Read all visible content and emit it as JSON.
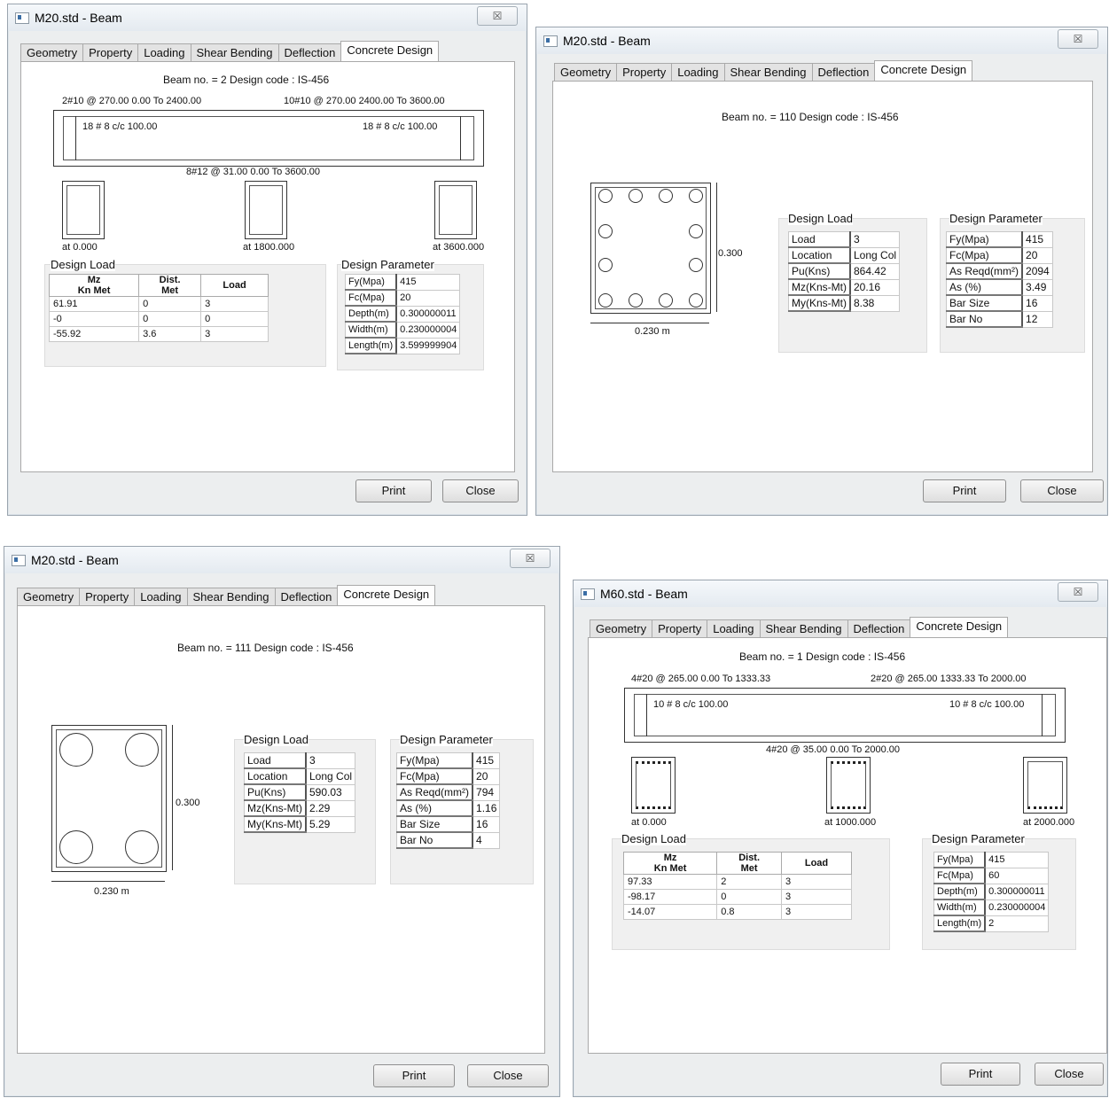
{
  "tabs": [
    "Geometry",
    "Property",
    "Loading",
    "Shear Bending",
    "Deflection",
    "Concrete Design"
  ],
  "close_x": "☒",
  "buttons": {
    "print": "Print",
    "close": "Close"
  },
  "d1": {
    "title": "M20.std - Beam",
    "beam_line": "Beam no. = 2  Design code :  IS-456",
    "top_left_bar": "2#10 @ 270.00 0.00 To 2400.00",
    "top_right_bar": "10#10 @ 270.00 2400.00 To 3600.00",
    "stirrup_left": "18 # 8 c/c 100.00",
    "stirrup_right": "18 # 8 c/c 100.00",
    "bottom_bar": "8#12 @ 31.00 0.00 To 3600.00",
    "sections": [
      "at 0.000",
      "at 1800.000",
      "at 3600.000"
    ],
    "design_load_label": "Design Load",
    "dl_headers": [
      "Mz\nKn Met",
      "Dist.\nMet",
      "Load"
    ],
    "dl_rows": [
      [
        "61.91",
        "0",
        "3"
      ],
      [
        "-0",
        "0",
        "0"
      ],
      [
        "-55.92",
        "3.6",
        "3"
      ]
    ],
    "design_param_label": "Design Parameter",
    "params": [
      [
        "Fy(Mpa)",
        "415"
      ],
      [
        "Fc(Mpa)",
        "20"
      ],
      [
        "Depth(m)",
        "0.300000011"
      ],
      [
        "Width(m)",
        "0.230000004"
      ],
      [
        "Length(m)",
        "3.599999904"
      ]
    ]
  },
  "d2": {
    "title": "M20.std - Beam",
    "beam_line": "Beam no. = 110  Design code :  IS-456",
    "depth_label": "0.300",
    "width_label": "0.230 m",
    "design_load_label": "Design Load",
    "loads": [
      [
        "Load",
        "3"
      ],
      [
        "Location",
        "Long Col"
      ],
      [
        "Pu(Kns)",
        "864.42"
      ],
      [
        "Mz(Kns-Mt)",
        "20.16"
      ],
      [
        "My(Kns-Mt)",
        "8.38"
      ]
    ],
    "design_param_label": "Design Parameter",
    "params": [
      [
        "Fy(Mpa)",
        "415"
      ],
      [
        "Fc(Mpa)",
        "20"
      ],
      [
        "As Reqd(mm²)",
        "2094"
      ],
      [
        "As (%)",
        "3.49"
      ],
      [
        "Bar Size",
        "16"
      ],
      [
        "Bar No",
        "12"
      ]
    ]
  },
  "d3": {
    "title": "M20.std - Beam",
    "beam_line": "Beam no. = 111  Design code :  IS-456",
    "depth_label": "0.300",
    "width_label": "0.230 m",
    "design_load_label": "Design Load",
    "loads": [
      [
        "Load",
        "3"
      ],
      [
        "Location",
        "Long Col"
      ],
      [
        "Pu(Kns)",
        "590.03"
      ],
      [
        "Mz(Kns-Mt)",
        "2.29"
      ],
      [
        "My(Kns-Mt)",
        "5.29"
      ]
    ],
    "design_param_label": "Design Parameter",
    "params": [
      [
        "Fy(Mpa)",
        "415"
      ],
      [
        "Fc(Mpa)",
        "20"
      ],
      [
        "As Reqd(mm²)",
        "794"
      ],
      [
        "As (%)",
        "1.16"
      ],
      [
        "Bar Size",
        "16"
      ],
      [
        "Bar No",
        "4"
      ]
    ]
  },
  "d4": {
    "title": "M60.std - Beam",
    "beam_line": "Beam no. = 1  Design code :  IS-456",
    "top_left_bar": "4#20 @ 265.00 0.00 To 1333.33",
    "top_right_bar": "2#20 @ 265.00 1333.33 To 2000.00",
    "stirrup_left": "10 # 8 c/c 100.00",
    "stirrup_right": "10 # 8 c/c 100.00",
    "bottom_bar": "4#20 @ 35.00 0.00 To 2000.00",
    "sections": [
      "at 0.000",
      "at 1000.000",
      "at 2000.000"
    ],
    "design_load_label": "Design Load",
    "dl_headers": [
      "Mz\nKn Met",
      "Dist.\nMet",
      "Load"
    ],
    "dl_rows": [
      [
        "97.33",
        "2",
        "3"
      ],
      [
        "-98.17",
        "0",
        "3"
      ],
      [
        "-14.07",
        "0.8",
        "3"
      ]
    ],
    "design_param_label": "Design Parameter",
    "params": [
      [
        "Fy(Mpa)",
        "415"
      ],
      [
        "Fc(Mpa)",
        "60"
      ],
      [
        "Depth(m)",
        "0.300000011"
      ],
      [
        "Width(m)",
        "0.230000004"
      ],
      [
        "Length(m)",
        "2"
      ]
    ]
  }
}
